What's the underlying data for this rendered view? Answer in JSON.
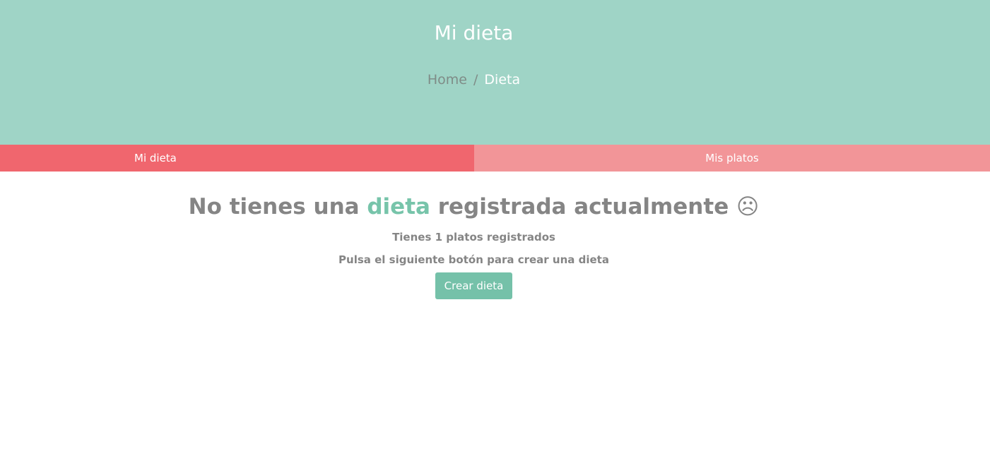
{
  "header": {
    "title": "Mi dieta",
    "breadcrumb": {
      "home": "Home",
      "separator": "/",
      "current": "Dieta"
    }
  },
  "tabs": [
    {
      "label": "Mi dieta",
      "active": true
    },
    {
      "label": "Mis platos",
      "active": false
    }
  ],
  "main": {
    "heading_before": "No tienes una ",
    "heading_accent": "dieta",
    "heading_after": " registrada actualmente ",
    "heading_emoji": "☹",
    "info": "Tienes 1 platos registrados",
    "instruction": "Pulsa el siguiente botón para crear una dieta",
    "create_button": "Crear dieta"
  },
  "colors": {
    "hero_bg": "#9fd4c6",
    "tab_active": "#f0666e",
    "tab_inactive": "#f29598",
    "accent": "#77c4aa",
    "button": "#75c1a9",
    "text": "#858585"
  },
  "icons": {
    "emoji": "sad-face-icon"
  }
}
